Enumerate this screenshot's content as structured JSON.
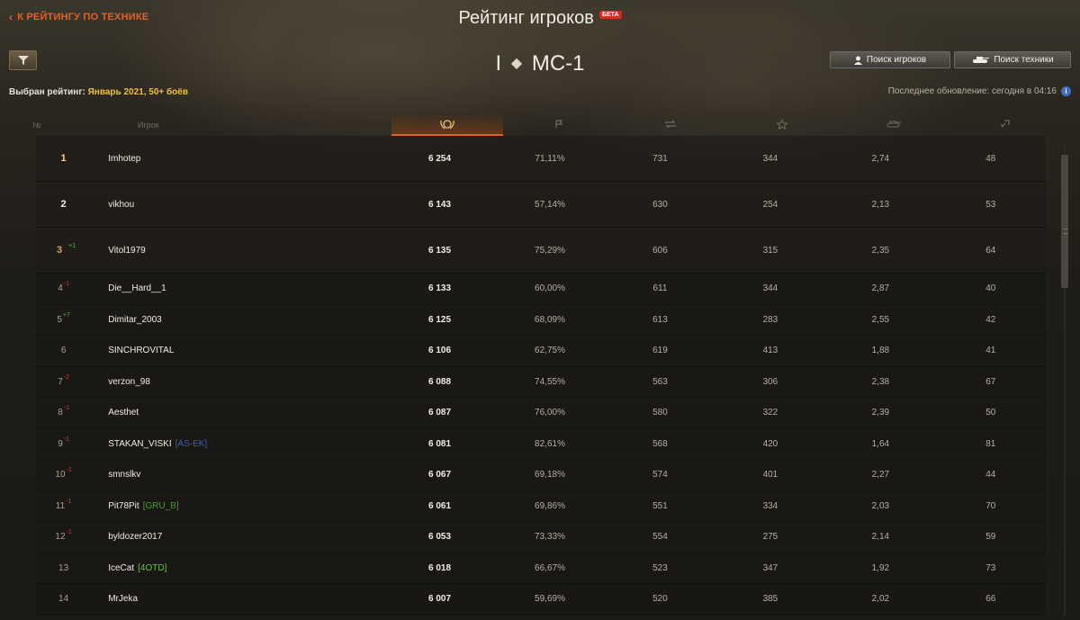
{
  "header": {
    "back_label": "К РЕЙТИНГУ ПО ТЕХНИКЕ",
    "title": "Рейтинг игроков",
    "beta_badge": "БЕТА",
    "vehicle_tier": "I",
    "vehicle_name": "МС-1",
    "players_search_label": "Поиск игроков",
    "tech_search_label": "Поиск техники",
    "selected_rating_label": "Выбран рейтинг:",
    "selected_rating_value": "Январь 2021, 50+ боёв",
    "last_update": "Последнее обновление: сегодня в 04:16"
  },
  "table": {
    "columns": [
      "№",
      "Игрок"
    ],
    "column_icons": [
      "rating-laurel-icon",
      "flag-icon",
      "damage-icon",
      "star-icon",
      "kills-icon",
      "assist-icon"
    ],
    "colors": {
      "accent": "#e0622a",
      "gold": "#f0c13a",
      "up": "#59b64a",
      "down": "#d23a2a"
    },
    "rows": [
      {
        "rank": "1",
        "change": "",
        "dir": "",
        "player": "Imhotep",
        "clan": "",
        "clan_color": "",
        "score": "6 254",
        "winrate": "71,11%",
        "damage": "731",
        "xp": "344",
        "kills": "2,74",
        "assist": "48"
      },
      {
        "rank": "2",
        "change": "",
        "dir": "",
        "player": "vikhou",
        "clan": "",
        "clan_color": "",
        "score": "6 143",
        "winrate": "57,14%",
        "damage": "630",
        "xp": "254",
        "kills": "2,13",
        "assist": "53"
      },
      {
        "rank": "3",
        "change": "+1",
        "dir": "up",
        "player": "Vitol1979",
        "clan": "",
        "clan_color": "",
        "score": "6 135",
        "winrate": "75,29%",
        "damage": "606",
        "xp": "315",
        "kills": "2,35",
        "assist": "64"
      },
      {
        "rank": "4",
        "change": "-1",
        "dir": "down",
        "player": "Die__Hard__1",
        "clan": "",
        "clan_color": "",
        "score": "6 133",
        "winrate": "60,00%",
        "damage": "611",
        "xp": "344",
        "kills": "2,87",
        "assist": "40"
      },
      {
        "rank": "5",
        "change": "+7",
        "dir": "up",
        "player": "Dimitar_2003",
        "clan": "",
        "clan_color": "",
        "score": "6 125",
        "winrate": "68,09%",
        "damage": "613",
        "xp": "283",
        "kills": "2,55",
        "assist": "42"
      },
      {
        "rank": "6",
        "change": "",
        "dir": "",
        "player": "SINCHROVITAL",
        "clan": "",
        "clan_color": "",
        "score": "6 106",
        "winrate": "62,75%",
        "damage": "619",
        "xp": "413",
        "kills": "1,88",
        "assist": "41"
      },
      {
        "rank": "7",
        "change": "-2",
        "dir": "down",
        "player": "verzon_98",
        "clan": "",
        "clan_color": "",
        "score": "6 088",
        "winrate": "74,55%",
        "damage": "563",
        "xp": "306",
        "kills": "2,38",
        "assist": "67"
      },
      {
        "rank": "8",
        "change": "-1",
        "dir": "down",
        "player": "Aesthet",
        "clan": "",
        "clan_color": "",
        "score": "6 087",
        "winrate": "76,00%",
        "damage": "580",
        "xp": "322",
        "kills": "2,39",
        "assist": "50"
      },
      {
        "rank": "9",
        "change": "-1",
        "dir": "down",
        "player": "STAKAN_VISKI",
        "clan": "[AS-EK]",
        "clan_color": "#3a5fb5",
        "score": "6 081",
        "winrate": "82,61%",
        "damage": "568",
        "xp": "420",
        "kills": "1,64",
        "assist": "81"
      },
      {
        "rank": "10",
        "change": "-1",
        "dir": "down",
        "player": "smnslkv",
        "clan": "",
        "clan_color": "",
        "score": "6 067",
        "winrate": "69,18%",
        "damage": "574",
        "xp": "401",
        "kills": "2,27",
        "assist": "44"
      },
      {
        "rank": "11",
        "change": "-1",
        "dir": "down",
        "player": "Pit78Pit",
        "clan": "[GRU_B]",
        "clan_color": "#4f9a3e",
        "score": "6 061",
        "winrate": "69,86%",
        "damage": "551",
        "xp": "334",
        "kills": "2,03",
        "assist": "70"
      },
      {
        "rank": "12",
        "change": "-1",
        "dir": "down",
        "player": "byldozer2017",
        "clan": "",
        "clan_color": "",
        "score": "6 053",
        "winrate": "73,33%",
        "damage": "554",
        "xp": "275",
        "kills": "2,14",
        "assist": "59"
      },
      {
        "rank": "13",
        "change": "",
        "dir": "",
        "player": "IceCat",
        "clan": "[4OTD]",
        "clan_color": "#6fbf4a",
        "score": "6 018",
        "winrate": "66,67%",
        "damage": "523",
        "xp": "347",
        "kills": "1,92",
        "assist": "73"
      },
      {
        "rank": "14",
        "change": "",
        "dir": "",
        "player": "MrJeka",
        "clan": "",
        "clan_color": "",
        "score": "6 007",
        "winrate": "59,69%",
        "damage": "520",
        "xp": "385",
        "kills": "2,02",
        "assist": "66"
      }
    ]
  }
}
